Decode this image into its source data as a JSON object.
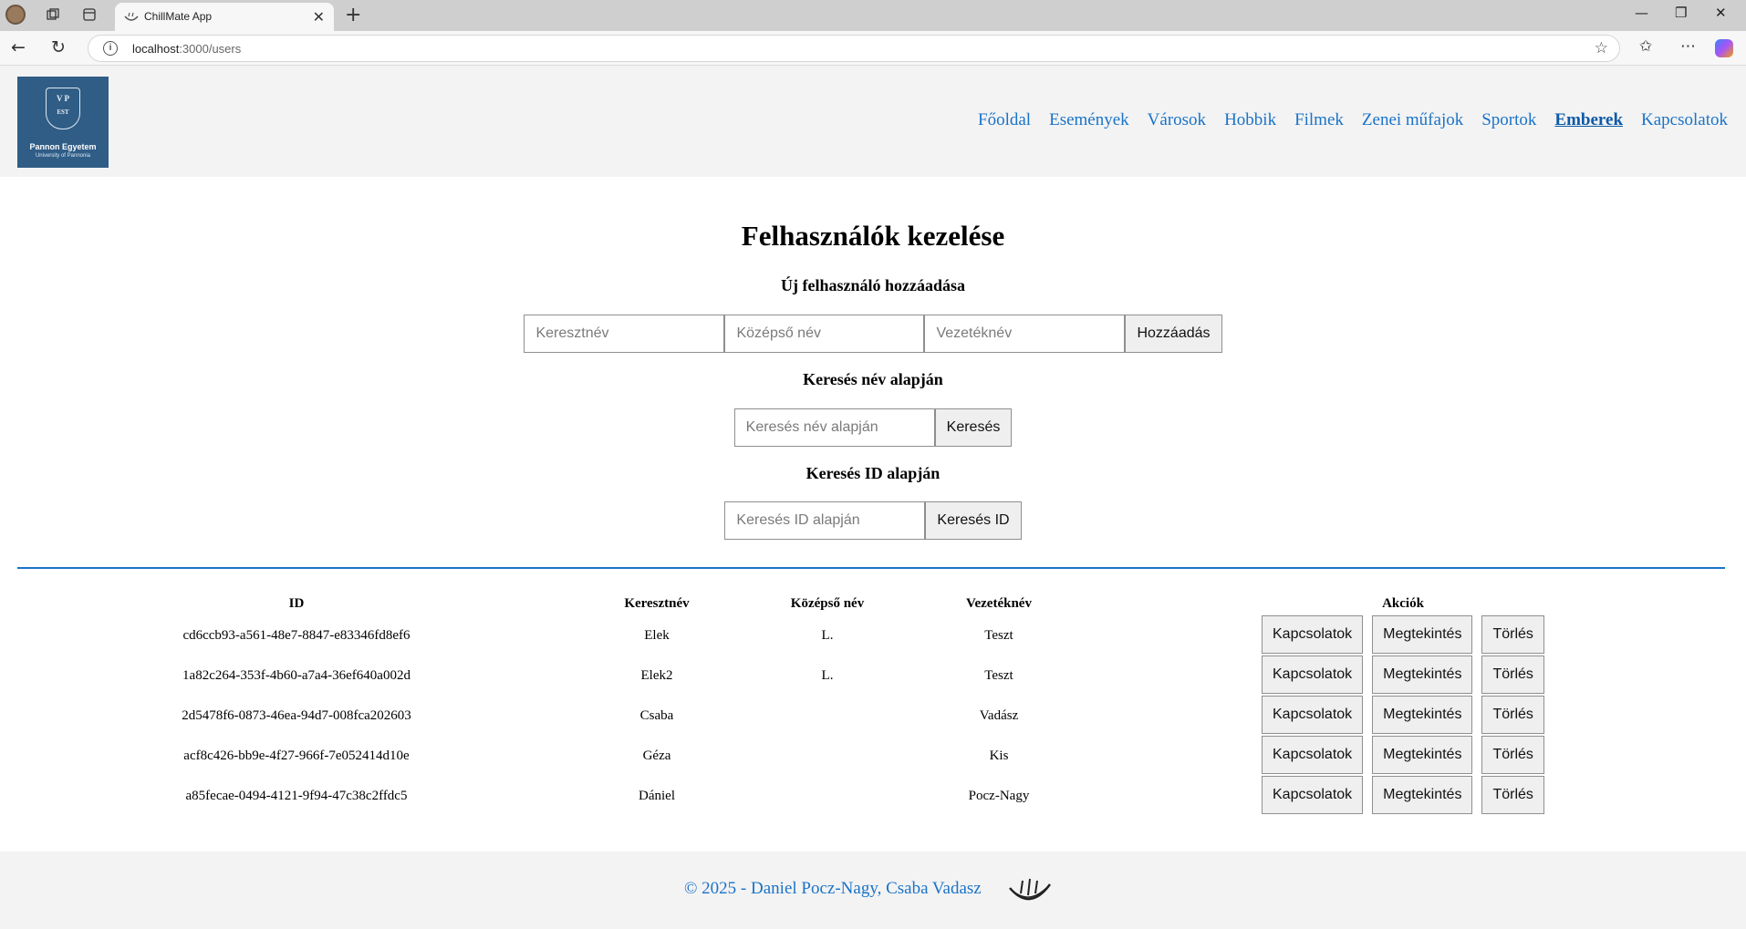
{
  "browser": {
    "tab_title": "ChillMate App",
    "tab_close": "✕",
    "new_tab": "+",
    "url_host": "localhost",
    "url_path": ":3000/users",
    "minimize": "—",
    "restore": "❐",
    "close": "✕",
    "back": "←",
    "reload": "↻",
    "star": "☆",
    "favorites": "✩",
    "more": "⋯"
  },
  "logo": {
    "crest_top": "V P",
    "crest_bottom": "EST",
    "name": "Pannon Egyetem",
    "subtitle": "University of Pannonia"
  },
  "nav": {
    "items": [
      {
        "label": "Főoldal"
      },
      {
        "label": "Események"
      },
      {
        "label": "Városok"
      },
      {
        "label": "Hobbik"
      },
      {
        "label": "Filmek"
      },
      {
        "label": "Zenei műfajok"
      },
      {
        "label": "Sportok"
      },
      {
        "label": "Emberek"
      },
      {
        "label": "Kapcsolatok"
      }
    ],
    "active": "Emberek"
  },
  "page": {
    "title": "Felhasználók kezelése"
  },
  "add_user": {
    "heading": "Új felhasználó hozzáadása",
    "first_name_placeholder": "Keresztnév",
    "middle_name_placeholder": "Középső név",
    "last_name_placeholder": "Vezetéknév",
    "submit_label": "Hozzáadás"
  },
  "search_name": {
    "heading": "Keresés név alapján",
    "placeholder": "Keresés név alapján",
    "button_label": "Keresés"
  },
  "search_id": {
    "heading": "Keresés ID alapján",
    "placeholder": "Keresés ID alapján",
    "button_label": "Keresés ID"
  },
  "table": {
    "headers": {
      "id": "ID",
      "first_name": "Keresztnév",
      "middle_name": "Középső név",
      "last_name": "Vezetéknév",
      "actions": "Akciók"
    },
    "action_labels": {
      "connections": "Kapcsolatok",
      "view": "Megtekintés",
      "delete": "Törlés"
    },
    "rows": [
      {
        "id": "cd6ccb93-a561-48e7-8847-e83346fd8ef6",
        "first_name": "Elek",
        "middle_name": "L.",
        "last_name": "Teszt"
      },
      {
        "id": "1a82c264-353f-4b60-a7a4-36ef640a002d",
        "first_name": "Elek2",
        "middle_name": "L.",
        "last_name": "Teszt"
      },
      {
        "id": "2d5478f6-0873-46ea-94d7-008fca202603",
        "first_name": "Csaba",
        "middle_name": "",
        "last_name": "Vadász"
      },
      {
        "id": "acf8c426-bb9e-4f27-966f-7e052414d10e",
        "first_name": "Géza",
        "middle_name": "",
        "last_name": "Kis"
      },
      {
        "id": "a85fecae-0494-4121-9f94-47c38c2ffdc5",
        "first_name": "Dániel",
        "middle_name": "",
        "last_name": "Pocz-Nagy"
      }
    ]
  },
  "footer": {
    "text": "© 2025 - Daniel Pocz-Nagy, Csaba Vadasz"
  },
  "colors": {
    "link": "#1a73c8",
    "divider": "#1a73c8",
    "header_bg": "#f3f3f3",
    "logo_bg": "#2f5d86"
  }
}
